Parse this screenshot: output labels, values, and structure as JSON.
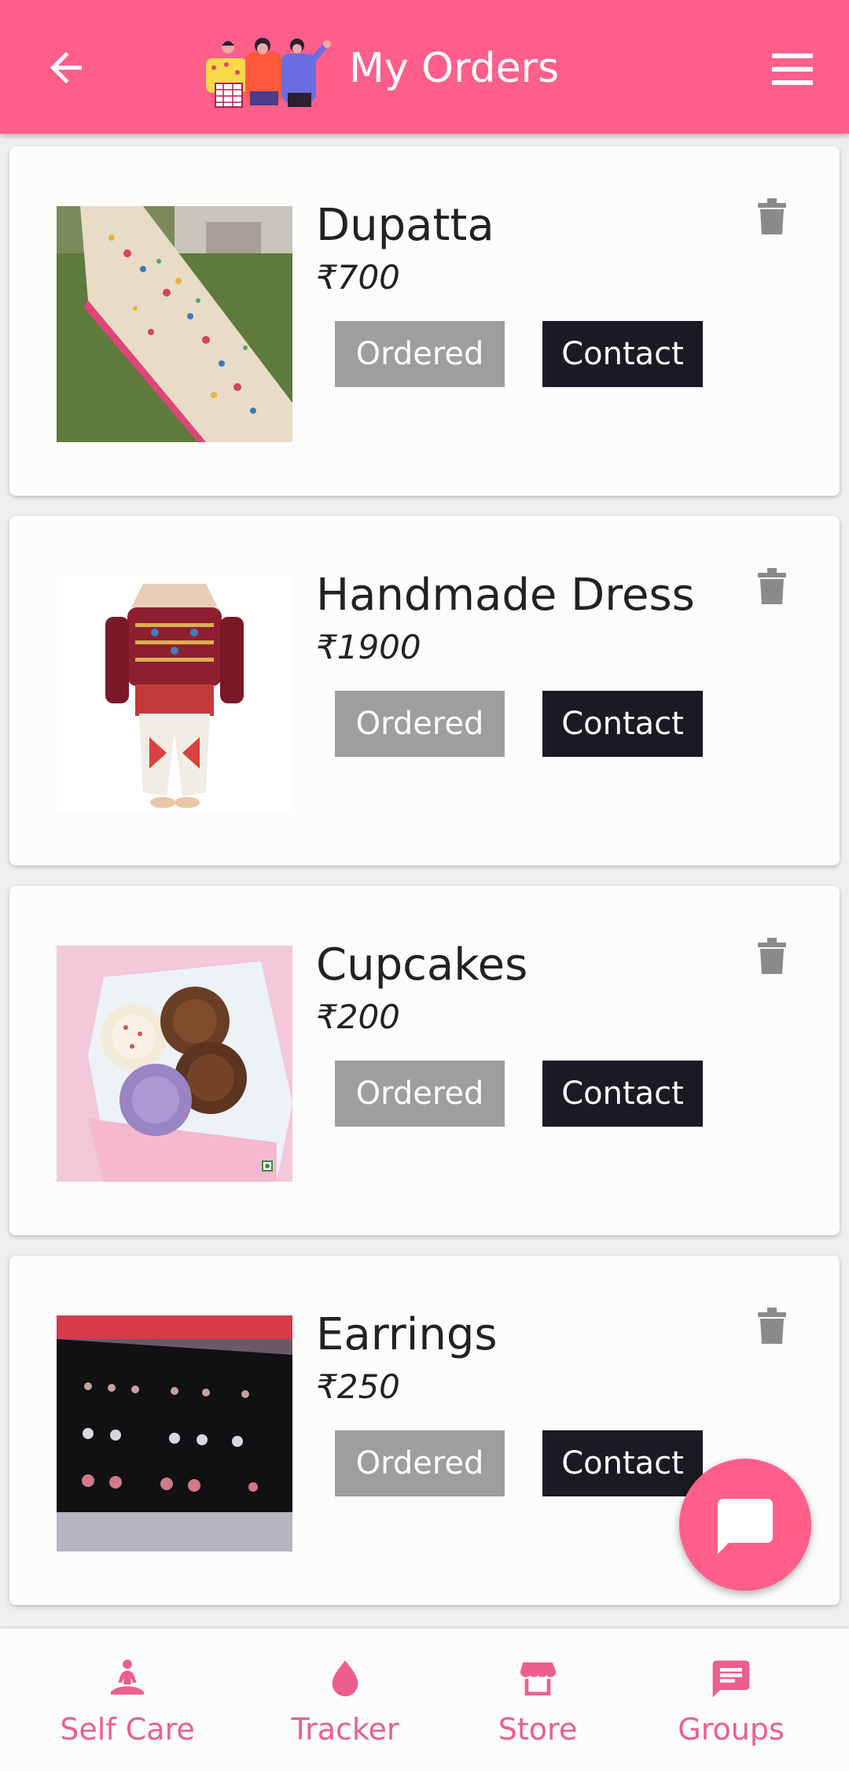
{
  "header": {
    "title": "My Orders"
  },
  "orders": [
    {
      "name": "Dupatta",
      "price": "₹700",
      "status": "Ordered",
      "action": "Contact"
    },
    {
      "name": "Handmade Dress",
      "price": "₹1900",
      "status": "Ordered",
      "action": "Contact"
    },
    {
      "name": "Cupcakes",
      "price": "₹200",
      "status": "Ordered",
      "action": "Contact"
    },
    {
      "name": "Earrings",
      "price": "₹250",
      "status": "Ordered",
      "action": "Contact"
    }
  ],
  "nav": [
    {
      "label": "Self Care",
      "icon": "meditation-icon"
    },
    {
      "label": "Tracker",
      "icon": "drop-icon"
    },
    {
      "label": "Store",
      "icon": "store-icon"
    },
    {
      "label": "Groups",
      "icon": "chat-icon"
    }
  ],
  "colors": {
    "accent": "#ff5f8a",
    "nav_label": "#ec5f8c",
    "ordered": "#9e9e9e",
    "contact": "#1a1a24"
  }
}
